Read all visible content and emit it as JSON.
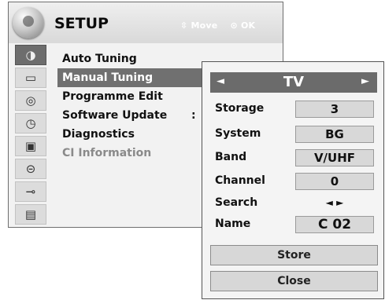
{
  "setup": {
    "title": "SETUP",
    "hint_move_icon": "⇳",
    "hint_move": "Move",
    "hint_ok_icon": "⊙",
    "hint_ok": "OK",
    "icons": [
      "satellite-dish-icon",
      "tv-icon",
      "disc-icon",
      "clock-icon",
      "lock-icon",
      "padlock-icon",
      "usb-icon",
      "clapperboard-icon"
    ],
    "items": [
      {
        "label": "Auto Tuning"
      },
      {
        "label": "Manual Tuning"
      },
      {
        "label": "Programme Edit"
      },
      {
        "label": "Software Update",
        "suffix": ":"
      },
      {
        "label": "Diagnostics"
      },
      {
        "label": "CI Information"
      }
    ]
  },
  "panel": {
    "left_arrow": "◄",
    "title": "TV",
    "right_arrow": "►",
    "rows": [
      {
        "label": "Storage",
        "value": "3"
      },
      {
        "label": "System",
        "value": "BG"
      },
      {
        "label": "Band",
        "value": "V/UHF"
      },
      {
        "label": "Channel",
        "value": "0"
      },
      {
        "label": "Search",
        "value": "◄ ►"
      },
      {
        "label": "Name",
        "value": "C  02"
      }
    ],
    "store": "Store",
    "close": "Close"
  }
}
